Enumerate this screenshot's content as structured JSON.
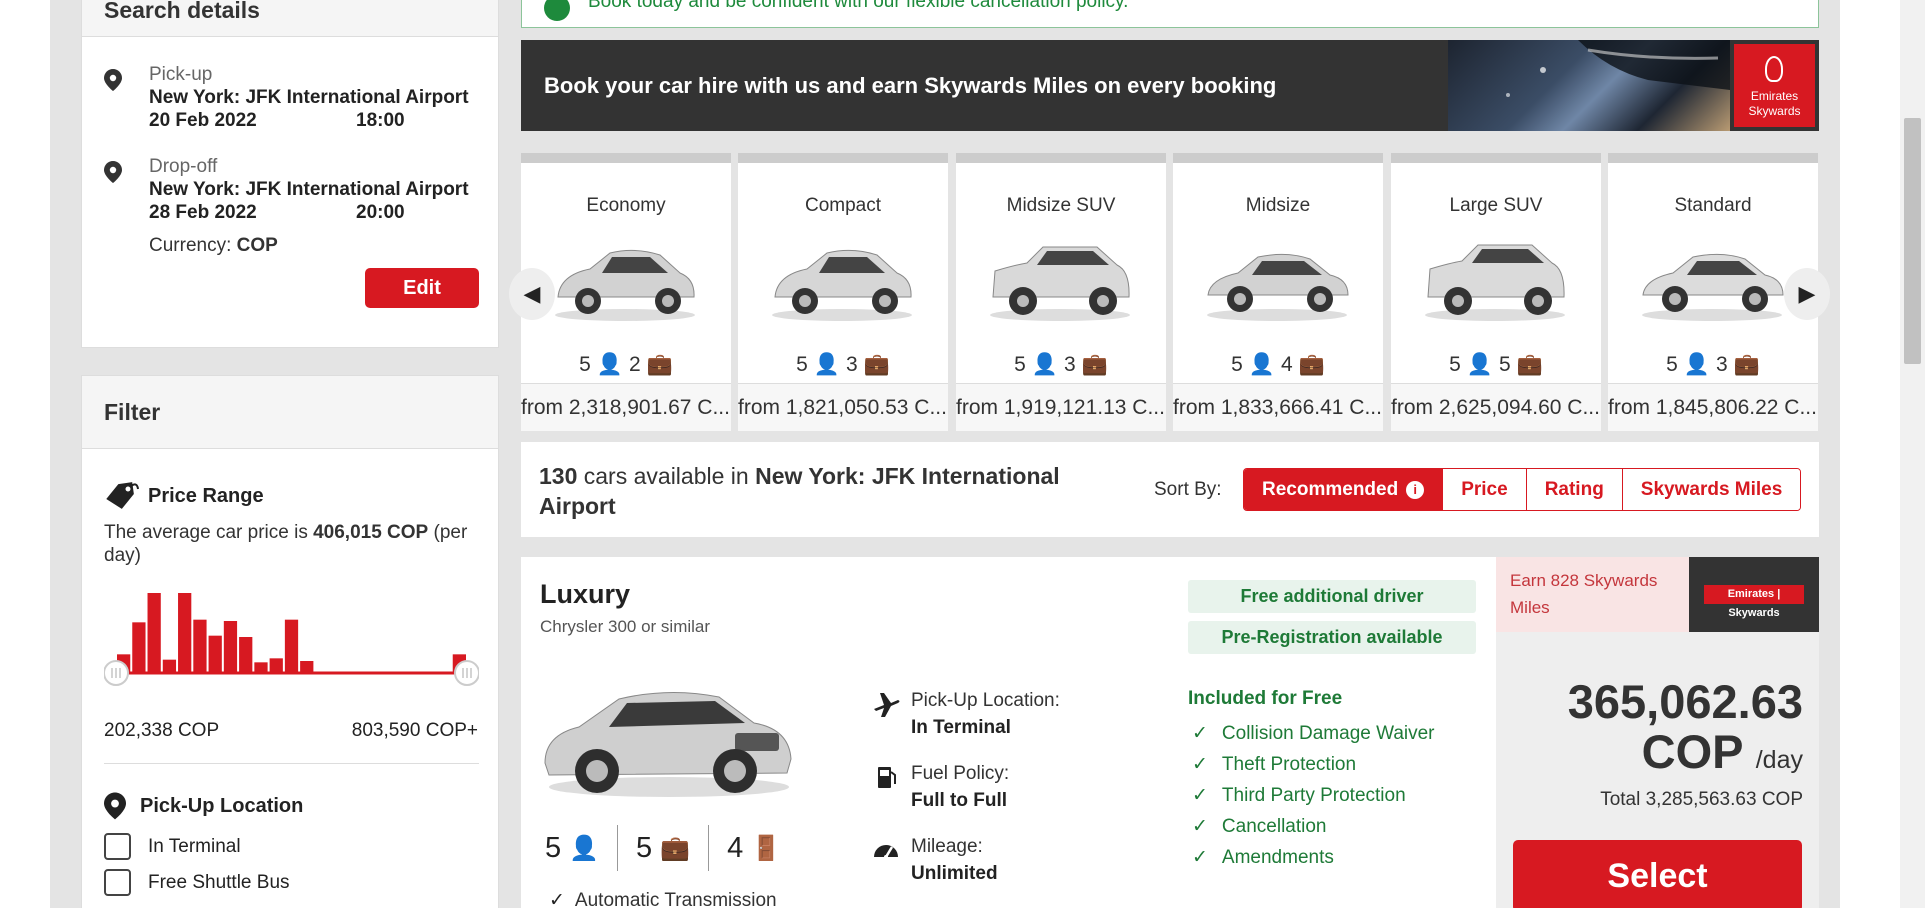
{
  "search": {
    "title": "Search details",
    "pickup_label": "Pick-up",
    "pickup_location": "New York: JFK International Airport",
    "pickup_date": "20 Feb 2022",
    "pickup_time": "18:00",
    "dropoff_label": "Drop-off",
    "dropoff_location": "New York: JFK International Airport",
    "dropoff_date": "28 Feb 2022",
    "dropoff_time": "20:00",
    "currency_label": "Currency:",
    "currency_value": "COP",
    "edit_label": "Edit"
  },
  "filter": {
    "title": "Filter",
    "price_range_title": "Price Range",
    "avg_text_before": "The average car price is ",
    "avg_value": "406,015 COP",
    "avg_text_after": " (per day)",
    "histogram": [
      14,
      38,
      60,
      10,
      60,
      40,
      28,
      39,
      27,
      8,
      11,
      40,
      9,
      0,
      0,
      0,
      0,
      0,
      0,
      0,
      0,
      0,
      14
    ],
    "range_min": "202,338 COP",
    "range_max": "803,590 COP+",
    "pickup_location_title": "Pick-Up Location",
    "pickup_options": [
      "In Terminal",
      "Free Shuttle Bus"
    ]
  },
  "notice": {
    "text": "Book today and be confident with our flexible cancellation policy."
  },
  "banner": {
    "text": "Book your car hire with us and earn Skywards Miles on every booking",
    "logo_line1": "Emirates",
    "logo_line2": "Skywards"
  },
  "categories": [
    {
      "name": "Economy",
      "seats": "5",
      "bags": "2",
      "price": "from 2,318,901.67 C..."
    },
    {
      "name": "Compact",
      "seats": "5",
      "bags": "3",
      "price": "from 1,821,050.53 C..."
    },
    {
      "name": "Midsize SUV",
      "seats": "5",
      "bags": "3",
      "price": "from 1,919,121.13 C..."
    },
    {
      "name": "Midsize",
      "seats": "5",
      "bags": "4",
      "price": "from 1,833,666.41 C..."
    },
    {
      "name": "Large SUV",
      "seats": "5",
      "bags": "5",
      "price": "from 2,625,094.60 C..."
    },
    {
      "name": "Standard",
      "seats": "5",
      "bags": "3",
      "price": "from 1,845,806.22 C..."
    }
  ],
  "results": {
    "count": "130",
    "text_mid": " cars available in ",
    "location": "New York: JFK International Airport",
    "sort_label": "Sort By:",
    "sort_options": [
      "Recommended",
      "Price",
      "Rating",
      "Skywards Miles"
    ],
    "sort_info_icon": "i"
  },
  "car": {
    "title": "Luxury",
    "subtitle": "Chrysler 300 or similar",
    "seats": "5",
    "bags": "5",
    "doors": "4",
    "transmission": "Automatic Transmission",
    "pickup_loc_label": "Pick-Up Location:",
    "pickup_loc_value": "In Terminal",
    "fuel_label": "Fuel Policy:",
    "fuel_value": "Full to Full",
    "mileage_label": "Mileage:",
    "mileage_value": "Unlimited",
    "pill_1": "Free additional driver",
    "pill_2": "Pre-Registration available",
    "included_title": "Included for Free",
    "included": [
      "Collision Damage Waiver",
      "Theft Protection",
      "Third Party Protection",
      "Cancellation",
      "Amendments"
    ],
    "miles_text": "Earn 828 Skywards Miles",
    "miles_logo": "Emirates | Skywards",
    "price_line1": "365,062.63",
    "price_line2": "COP",
    "per_day": "/day",
    "total": "Total 3,285,563.63 COP",
    "select_label": "Select"
  },
  "colors": {
    "brand_red": "#d71921",
    "green": "#1e7a37"
  }
}
